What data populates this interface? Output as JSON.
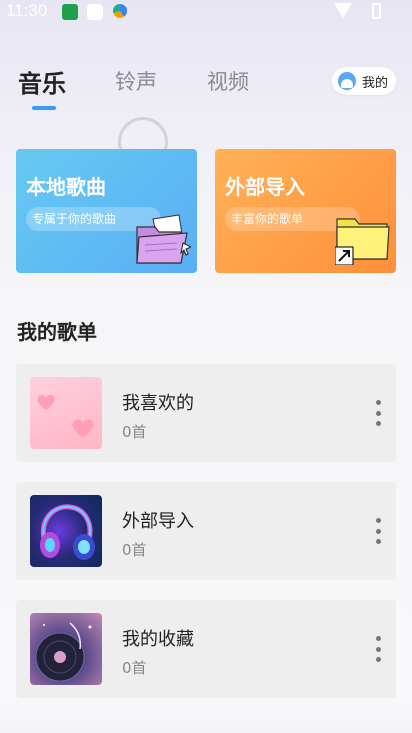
{
  "status_bar": {
    "time": "11:30"
  },
  "tabs": [
    {
      "label": "音乐",
      "active": true
    },
    {
      "label": "铃声",
      "active": false
    },
    {
      "label": "视频",
      "active": false
    }
  ],
  "mine_button": {
    "label": "我的",
    "icon": "avatar-icon"
  },
  "cards": {
    "local": {
      "title": "本地歌曲",
      "subtitle": "专属于你的歌曲",
      "icon": "purple-folder-icon"
    },
    "import": {
      "title": "外部导入",
      "subtitle": "丰富你的歌单",
      "icon": "yellow-folder-shortcut-icon"
    }
  },
  "section": {
    "title": "我的歌单"
  },
  "playlists": [
    {
      "name": "我喜欢的",
      "count": "0首",
      "thumb": "pink-hearts"
    },
    {
      "name": "外部导入",
      "count": "0首",
      "thumb": "headphones"
    },
    {
      "name": "我的收藏",
      "count": "0首",
      "thumb": "vinyl"
    }
  ],
  "colors": {
    "accent": "#3a9bff",
    "local_card": "#5fb8f4",
    "import_card": "#ff9f48"
  }
}
